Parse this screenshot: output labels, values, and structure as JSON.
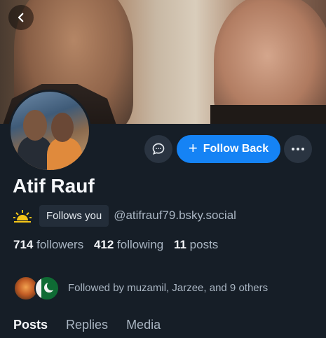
{
  "header": {
    "back_icon": "chevron-left-icon"
  },
  "profile": {
    "name": "Atif Rauf",
    "follows_you_label": "Follows you",
    "handle": "@atifrauf79.bsky.social",
    "status_icon": "sun-icon"
  },
  "actions": {
    "message_icon": "chat-bubble-icon",
    "follow_back_label": "Follow Back",
    "follow_plus": "+",
    "more_icon": "ellipsis-icon"
  },
  "stats": {
    "followers_count": "714",
    "followers_label": "followers",
    "following_count": "412",
    "following_label": "following",
    "posts_count": "11",
    "posts_label": "posts"
  },
  "followed_by": {
    "text": "Followed by muzamil, Jarzee, and 9 others"
  },
  "tabs": [
    {
      "label": "Posts"
    },
    {
      "label": "Replies"
    },
    {
      "label": "Media"
    }
  ],
  "colors": {
    "background": "#161e27",
    "accent": "#1583f5",
    "button_bg": "#2a3441"
  }
}
